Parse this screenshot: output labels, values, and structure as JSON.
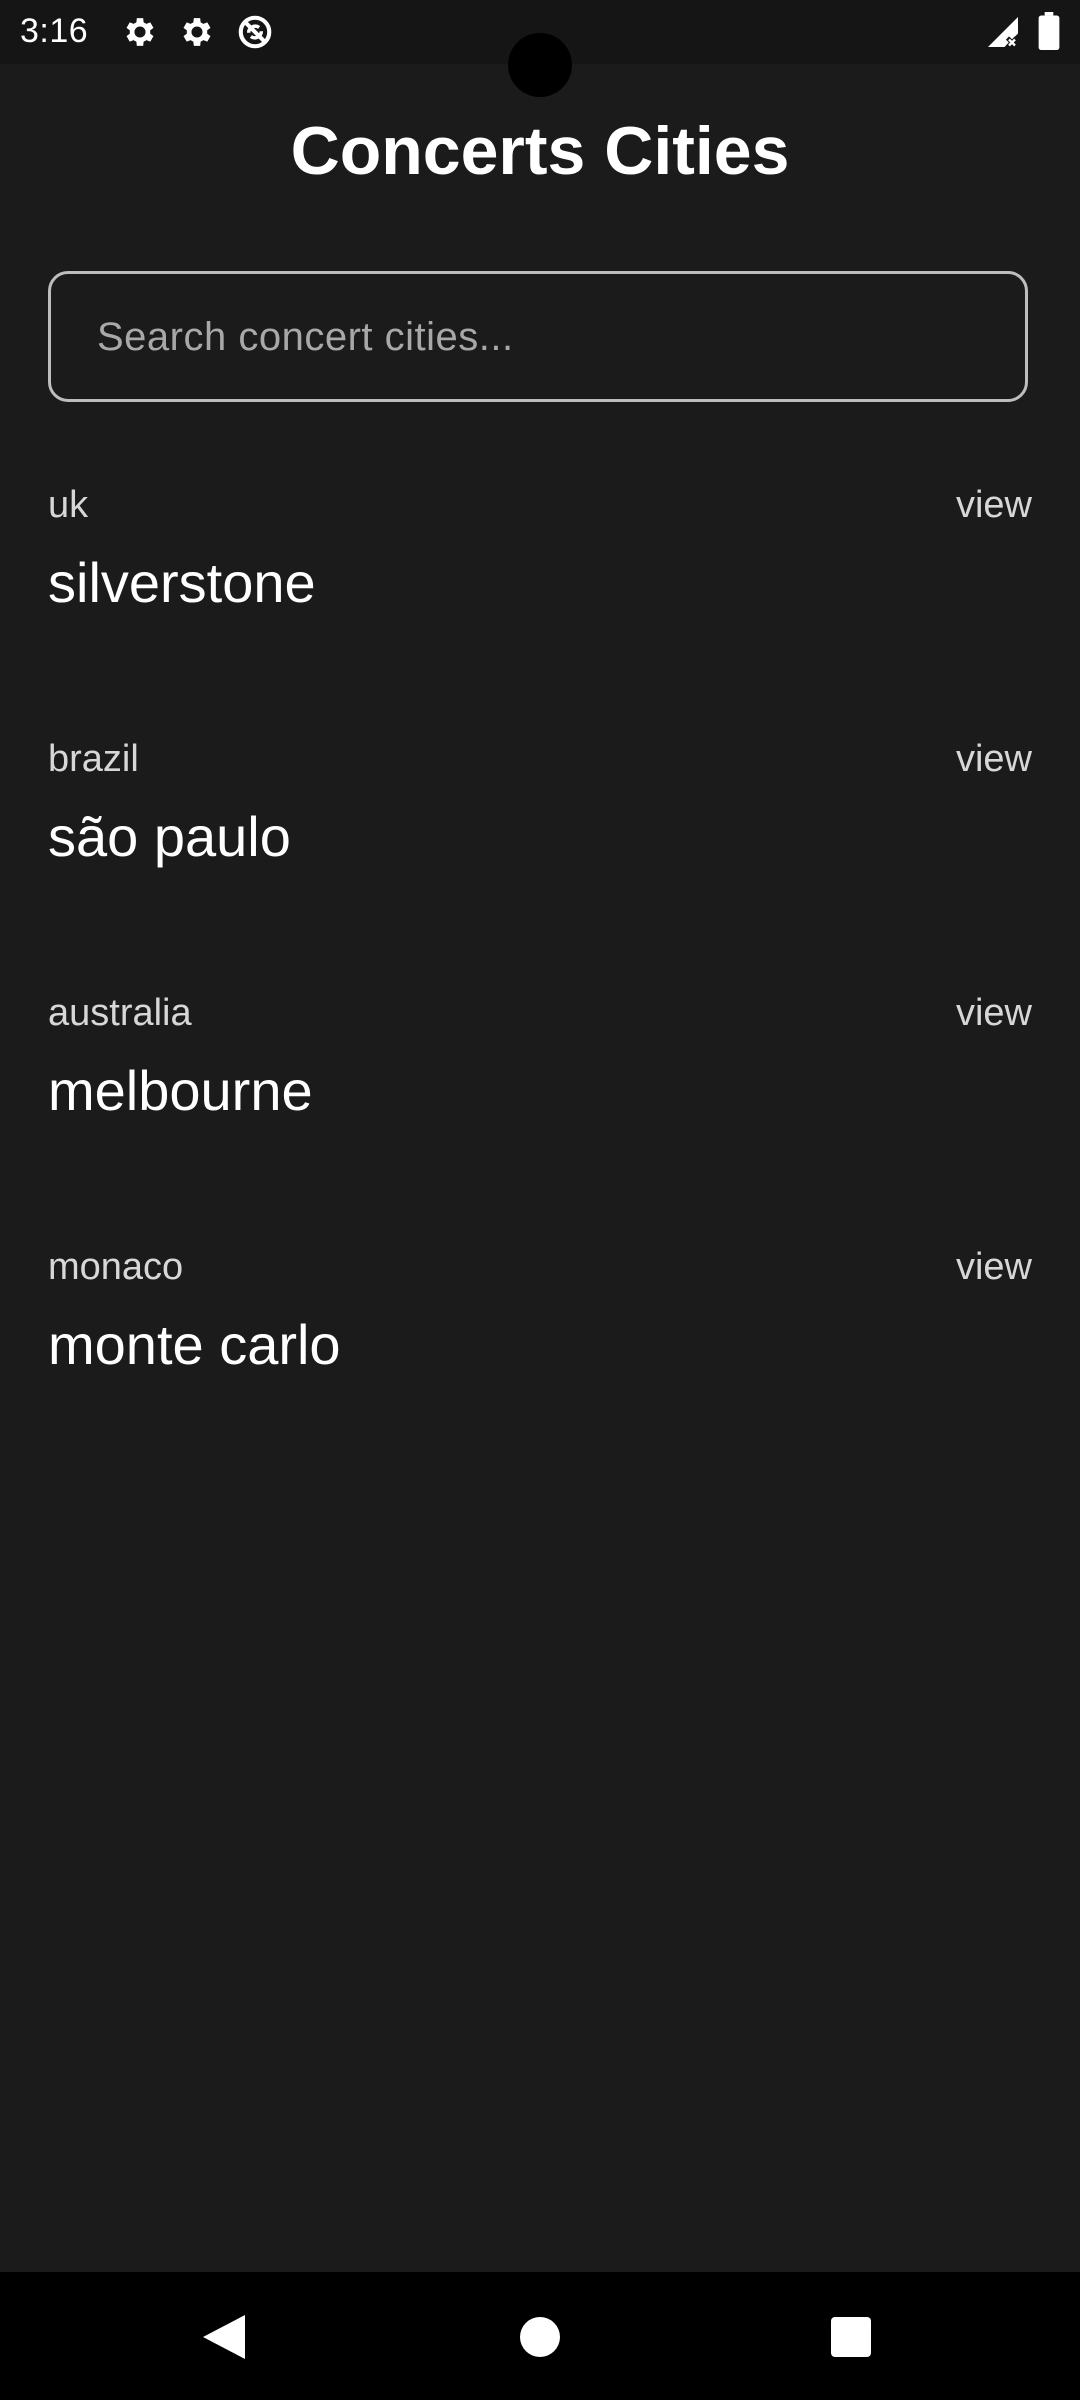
{
  "status_bar": {
    "time": "3:16",
    "icons": [
      "gear-icon",
      "gear-icon",
      "no-sync-icon",
      "signal-icon",
      "battery-icon"
    ]
  },
  "header": {
    "title": "Concerts Cities"
  },
  "search": {
    "placeholder": "Search concert cities...",
    "value": ""
  },
  "cities": [
    {
      "country": "uk",
      "city": "silverstone",
      "action": "view"
    },
    {
      "country": "brazil",
      "city": "são paulo",
      "action": "view"
    },
    {
      "country": "australia",
      "city": "melbourne",
      "action": "view"
    },
    {
      "country": "monaco",
      "city": "monte carlo",
      "action": "view"
    }
  ],
  "nav_bar": {
    "icons": [
      "back-icon",
      "home-icon",
      "recents-icon"
    ]
  },
  "colors": {
    "background": "#1b1b1b",
    "text_primary": "#ffffff",
    "text_secondary": "#d7d7d7",
    "search_border": "#bdbdbd"
  }
}
